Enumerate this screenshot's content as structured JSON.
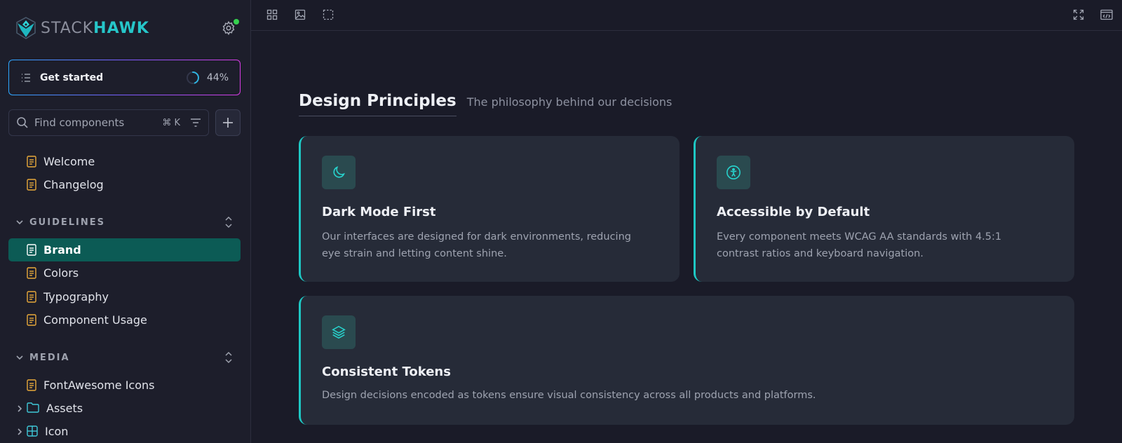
{
  "brand": {
    "name_part1": "STACK",
    "name_part2": "HAWK"
  },
  "get_started": {
    "label": "Get started",
    "progress_text": "44%",
    "progress": 0.44
  },
  "search": {
    "placeholder": "Find components",
    "shortcut": "⌘ K"
  },
  "sidebar": {
    "top_items": [
      {
        "label": "Welcome"
      },
      {
        "label": "Changelog"
      }
    ],
    "sections": [
      {
        "title": "GUIDELINES",
        "items": [
          {
            "label": "Brand",
            "active": true
          },
          {
            "label": "Colors"
          },
          {
            "label": "Typography"
          },
          {
            "label": "Component Usage"
          }
        ]
      },
      {
        "title": "MEDIA",
        "items": [
          {
            "label": "FontAwesome Icons",
            "icon": "doc-icon"
          },
          {
            "label": "Assets",
            "icon": "folder-icon"
          },
          {
            "label": "Icon",
            "icon": "component-icon"
          }
        ]
      }
    ]
  },
  "page": {
    "title": "Design Principles",
    "subtitle": "The philosophy behind our decisions",
    "cards": [
      {
        "icon": "moon-icon",
        "title": "Dark Mode First",
        "description": "Our interfaces are designed for dark environments, reducing eye strain and letting content shine."
      },
      {
        "icon": "accessibility-icon",
        "title": "Accessible by Default",
        "description": "Every component meets WCAG AA standards with 4.5:1 contrast ratios and keyboard navigation."
      },
      {
        "icon": "layers-icon",
        "title": "Consistent Tokens",
        "description": "Design decisions encoded as tokens ensure visual consistency across all products and platforms."
      }
    ]
  },
  "colors": {
    "accent": "#1ec8c4",
    "active_nav": "#0c5b55",
    "doc_icon": "#e8a93a",
    "folder_icon": "#3fc8d8",
    "status_dot": "#35d04e"
  }
}
